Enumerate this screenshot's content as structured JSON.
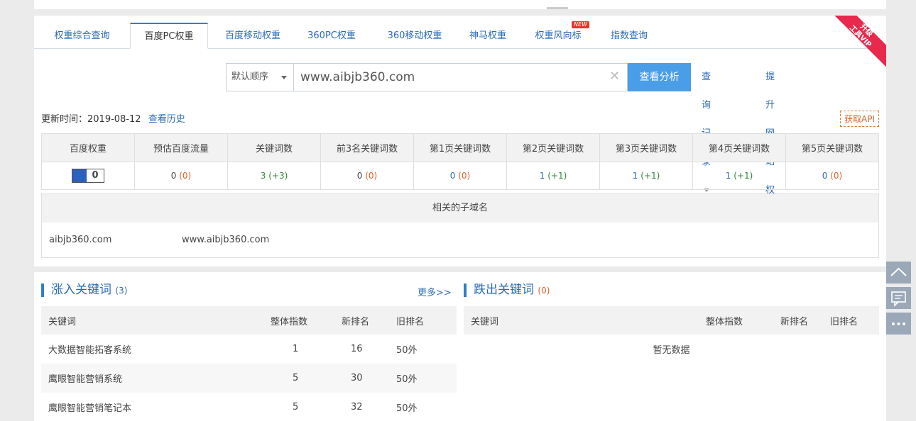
{
  "tabs": [
    {
      "label": "权重综合查询"
    },
    {
      "label": "百度PC权重"
    },
    {
      "label": "百度移动权重"
    },
    {
      "label": "360PC权重"
    },
    {
      "label": "360移动权重"
    },
    {
      "label": "神马权重"
    },
    {
      "label": "权重风向标"
    },
    {
      "label": "指数查询"
    }
  ],
  "new_badge": "NEW",
  "vip_ribbon": {
    "line1": "升级",
    "line2": "工具VIP"
  },
  "search": {
    "order_label": "默认顺序",
    "value": "www.aibjb360.com",
    "button": "查看分析",
    "history": "查询记录",
    "boost": "提升网站权重"
  },
  "update": {
    "label": "更新时间：2019-08-12",
    "history_link": "查看历史"
  },
  "api_button": "获取API",
  "stats": {
    "headers": [
      "百度权重",
      "预估百度流量",
      "关键词数",
      "前3名关键词数",
      "第1页关键词数",
      "第2页关键词数",
      "第3页关键词数",
      "第4页关键词数",
      "第5页关键词数"
    ],
    "weight": "0",
    "cells": [
      {
        "main": "0",
        "delta": "(0)"
      },
      {
        "main": "3",
        "delta": "(+3)"
      },
      {
        "main": "0",
        "delta": "(0)"
      },
      {
        "main": "0",
        "delta": "(0)"
      },
      {
        "main": "1",
        "delta": "(+1)"
      },
      {
        "main": "1",
        "delta": "(+1)"
      },
      {
        "main": "1",
        "delta": "(+1)"
      },
      {
        "main": "0",
        "delta": "(0)"
      }
    ]
  },
  "subdomains": {
    "title": "相关的子域名",
    "items": [
      "aibjb360.com",
      "www.aibjb360.com"
    ]
  },
  "rising": {
    "title": "涨入关键词",
    "count": "(3)",
    "more": "更多>>",
    "headers": [
      "关键词",
      "整体指数",
      "新排名",
      "旧排名"
    ],
    "rows": [
      {
        "kw": "大数据智能拓客系统",
        "index": "1",
        "new": "16",
        "old": "50外"
      },
      {
        "kw": "鹰眼智能营销系统",
        "index": "5",
        "new": "30",
        "old": "50外"
      },
      {
        "kw": "鹰眼智能营销笔记本",
        "index": "5",
        "new": "32",
        "old": "50外"
      }
    ]
  },
  "falling": {
    "title": "跌出关键词",
    "count": "(0)",
    "headers": [
      "关键词",
      "整体指数",
      "新排名",
      "旧排名"
    ],
    "empty": "暂无数据"
  }
}
